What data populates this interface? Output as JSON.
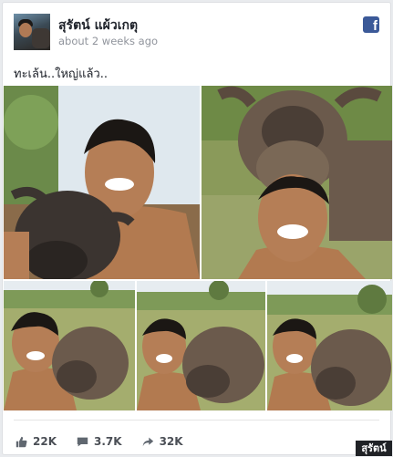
{
  "post": {
    "author": "สุรัตน์ แผ้วเกตุ",
    "time": "about 2 weeks ago",
    "text": "ทะเล้น..ใหญ่แล้ว..",
    "platform_icon": "facebook-icon"
  },
  "photos": [
    {
      "name": "photo-man-selfie-with-buffalo-1"
    },
    {
      "name": "photo-buffalo-above-man"
    },
    {
      "name": "photo-man-hug-buffalo-1"
    },
    {
      "name": "photo-man-hug-buffalo-2"
    },
    {
      "name": "photo-man-hug-buffalo-3"
    }
  ],
  "stats": {
    "likes": "22K",
    "comments": "3.7K",
    "shares": "32K",
    "icons": [
      "like-icon",
      "comment-icon",
      "share-icon"
    ]
  },
  "watermark": "สุรัตน์",
  "colors": {
    "facebook_blue": "#3b5998",
    "meta_gray": "#90949c"
  }
}
